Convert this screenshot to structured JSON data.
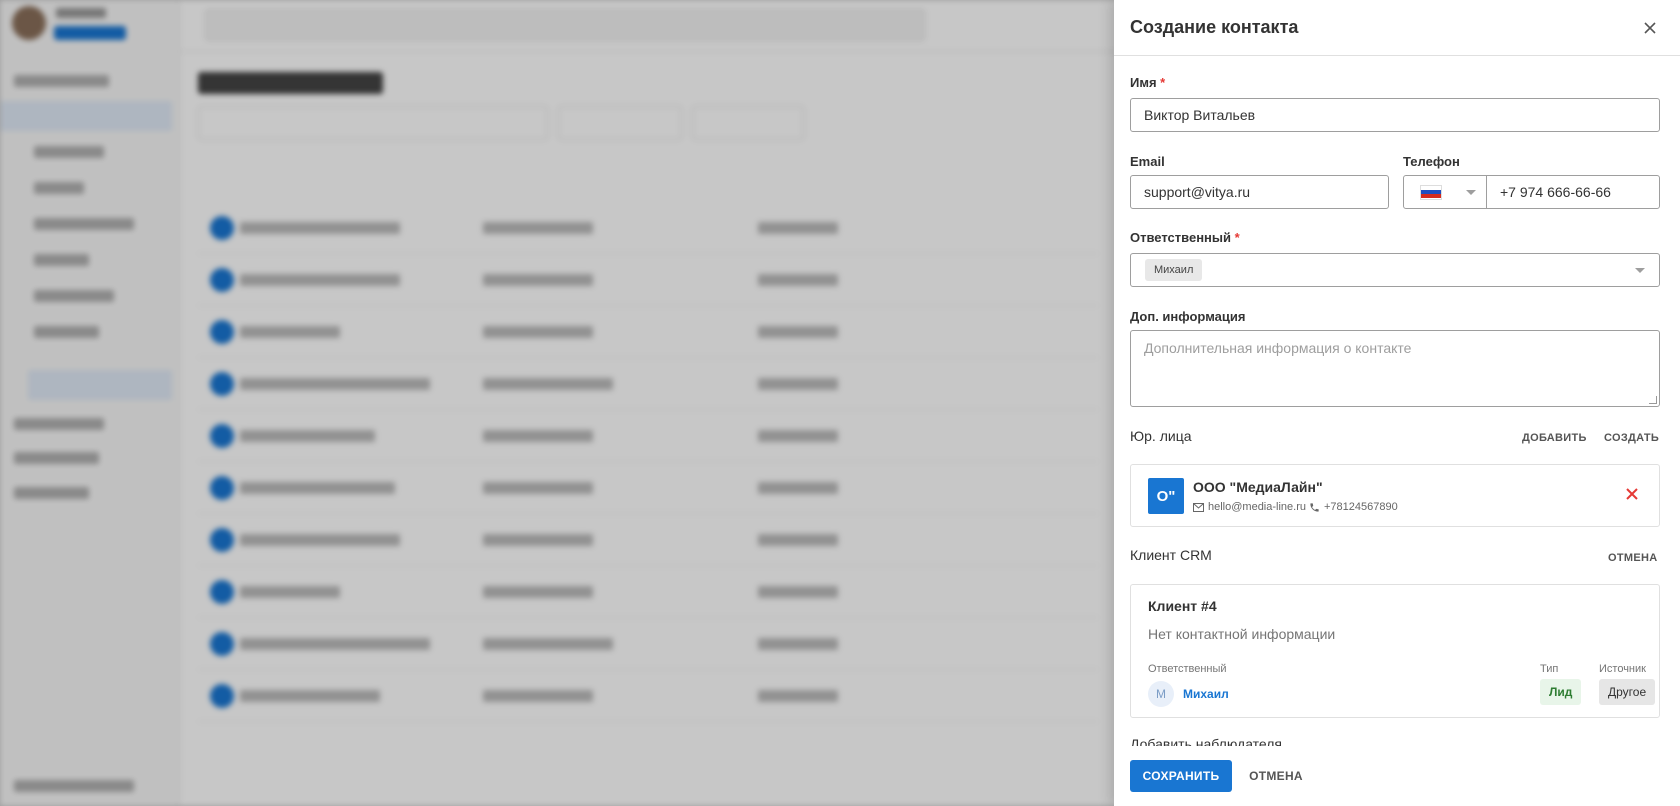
{
  "drawer": {
    "title": "Создание контакта",
    "name_label": "Имя",
    "name_value": "Виктор Витальев",
    "email_label": "Email",
    "email_value": "support@vitya.ru",
    "phone_label": "Телефон",
    "phone_value": "+7 974 666-66-66",
    "responsible_label": "Ответственный",
    "responsible_chip": "Михаил",
    "info_label": "Доп. информация",
    "info_placeholder": "Дополнительная информация о контакте",
    "required_mark": "*",
    "legal": {
      "title": "Юр. лица",
      "add_label": "ДОБАВИТЬ",
      "create_label": "СОЗДАТЬ",
      "org_initials": "О\"",
      "org_name": "ООО \"МедиаЛайн\"",
      "org_email": "hello@media-line.ru",
      "org_phone": "+78124567890"
    },
    "crm": {
      "title": "Клиент CRM",
      "cancel_label": "ОТМЕНА",
      "client_title": "Клиент #4",
      "empty_text": "Нет контактной информации",
      "responsible_label": "Ответственный",
      "person_initial": "М",
      "person_name": "Михаил",
      "type_label": "Тип",
      "type_value": "Лид",
      "source_label": "Источник",
      "source_value": "Другое"
    },
    "cut_section": "Добавить наблюдателя",
    "save_label": "СОХРАНИТЬ",
    "cancel_label": "ОТМЕНА"
  },
  "colors": {
    "accent": "#1976d2",
    "danger": "#e53935",
    "lead_bg": "#e8f5e9",
    "lead_text": "#2e7d32"
  }
}
